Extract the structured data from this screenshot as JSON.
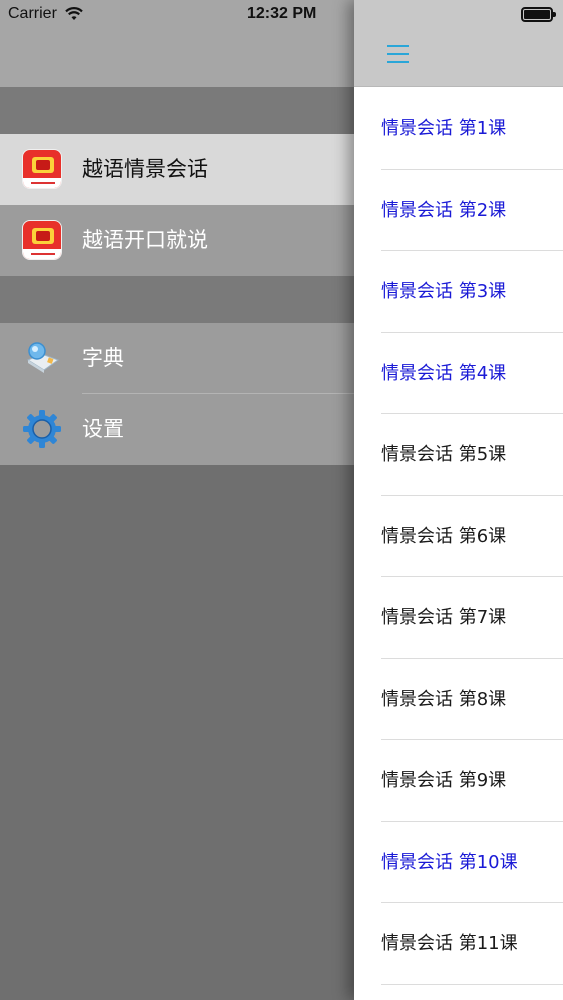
{
  "status_bar": {
    "carrier": "Carrier",
    "time": "12:32 PM"
  },
  "drawer": {
    "apps": [
      {
        "label": "越语情景会话",
        "icon": "app-logo-icon"
      },
      {
        "label": "越语开口就说",
        "icon": "app-logo-icon"
      }
    ],
    "tools": [
      {
        "label": "字典",
        "icon": "dictionary-icon"
      },
      {
        "label": "设置",
        "icon": "gear-icon"
      }
    ]
  },
  "header": {
    "menu_icon": "hamburger-menu-icon"
  },
  "lessons": [
    {
      "label": "情景会话 第1课",
      "visited": true
    },
    {
      "label": "情景会话 第2课",
      "visited": true
    },
    {
      "label": "情景会话 第3课",
      "visited": true
    },
    {
      "label": "情景会话 第4课",
      "visited": true
    },
    {
      "label": "情景会话 第5课",
      "visited": false
    },
    {
      "label": "情景会话 第6课",
      "visited": false
    },
    {
      "label": "情景会话 第7课",
      "visited": false
    },
    {
      "label": "情景会话 第8课",
      "visited": false
    },
    {
      "label": "情景会话 第9课",
      "visited": false
    },
    {
      "label": "情景会话 第10课",
      "visited": true
    },
    {
      "label": "情景会话 第11课",
      "visited": false
    }
  ],
  "colors": {
    "visited_link": "#1a1ad6",
    "accent": "#2aa6d8",
    "app_red": "#e8302a"
  }
}
